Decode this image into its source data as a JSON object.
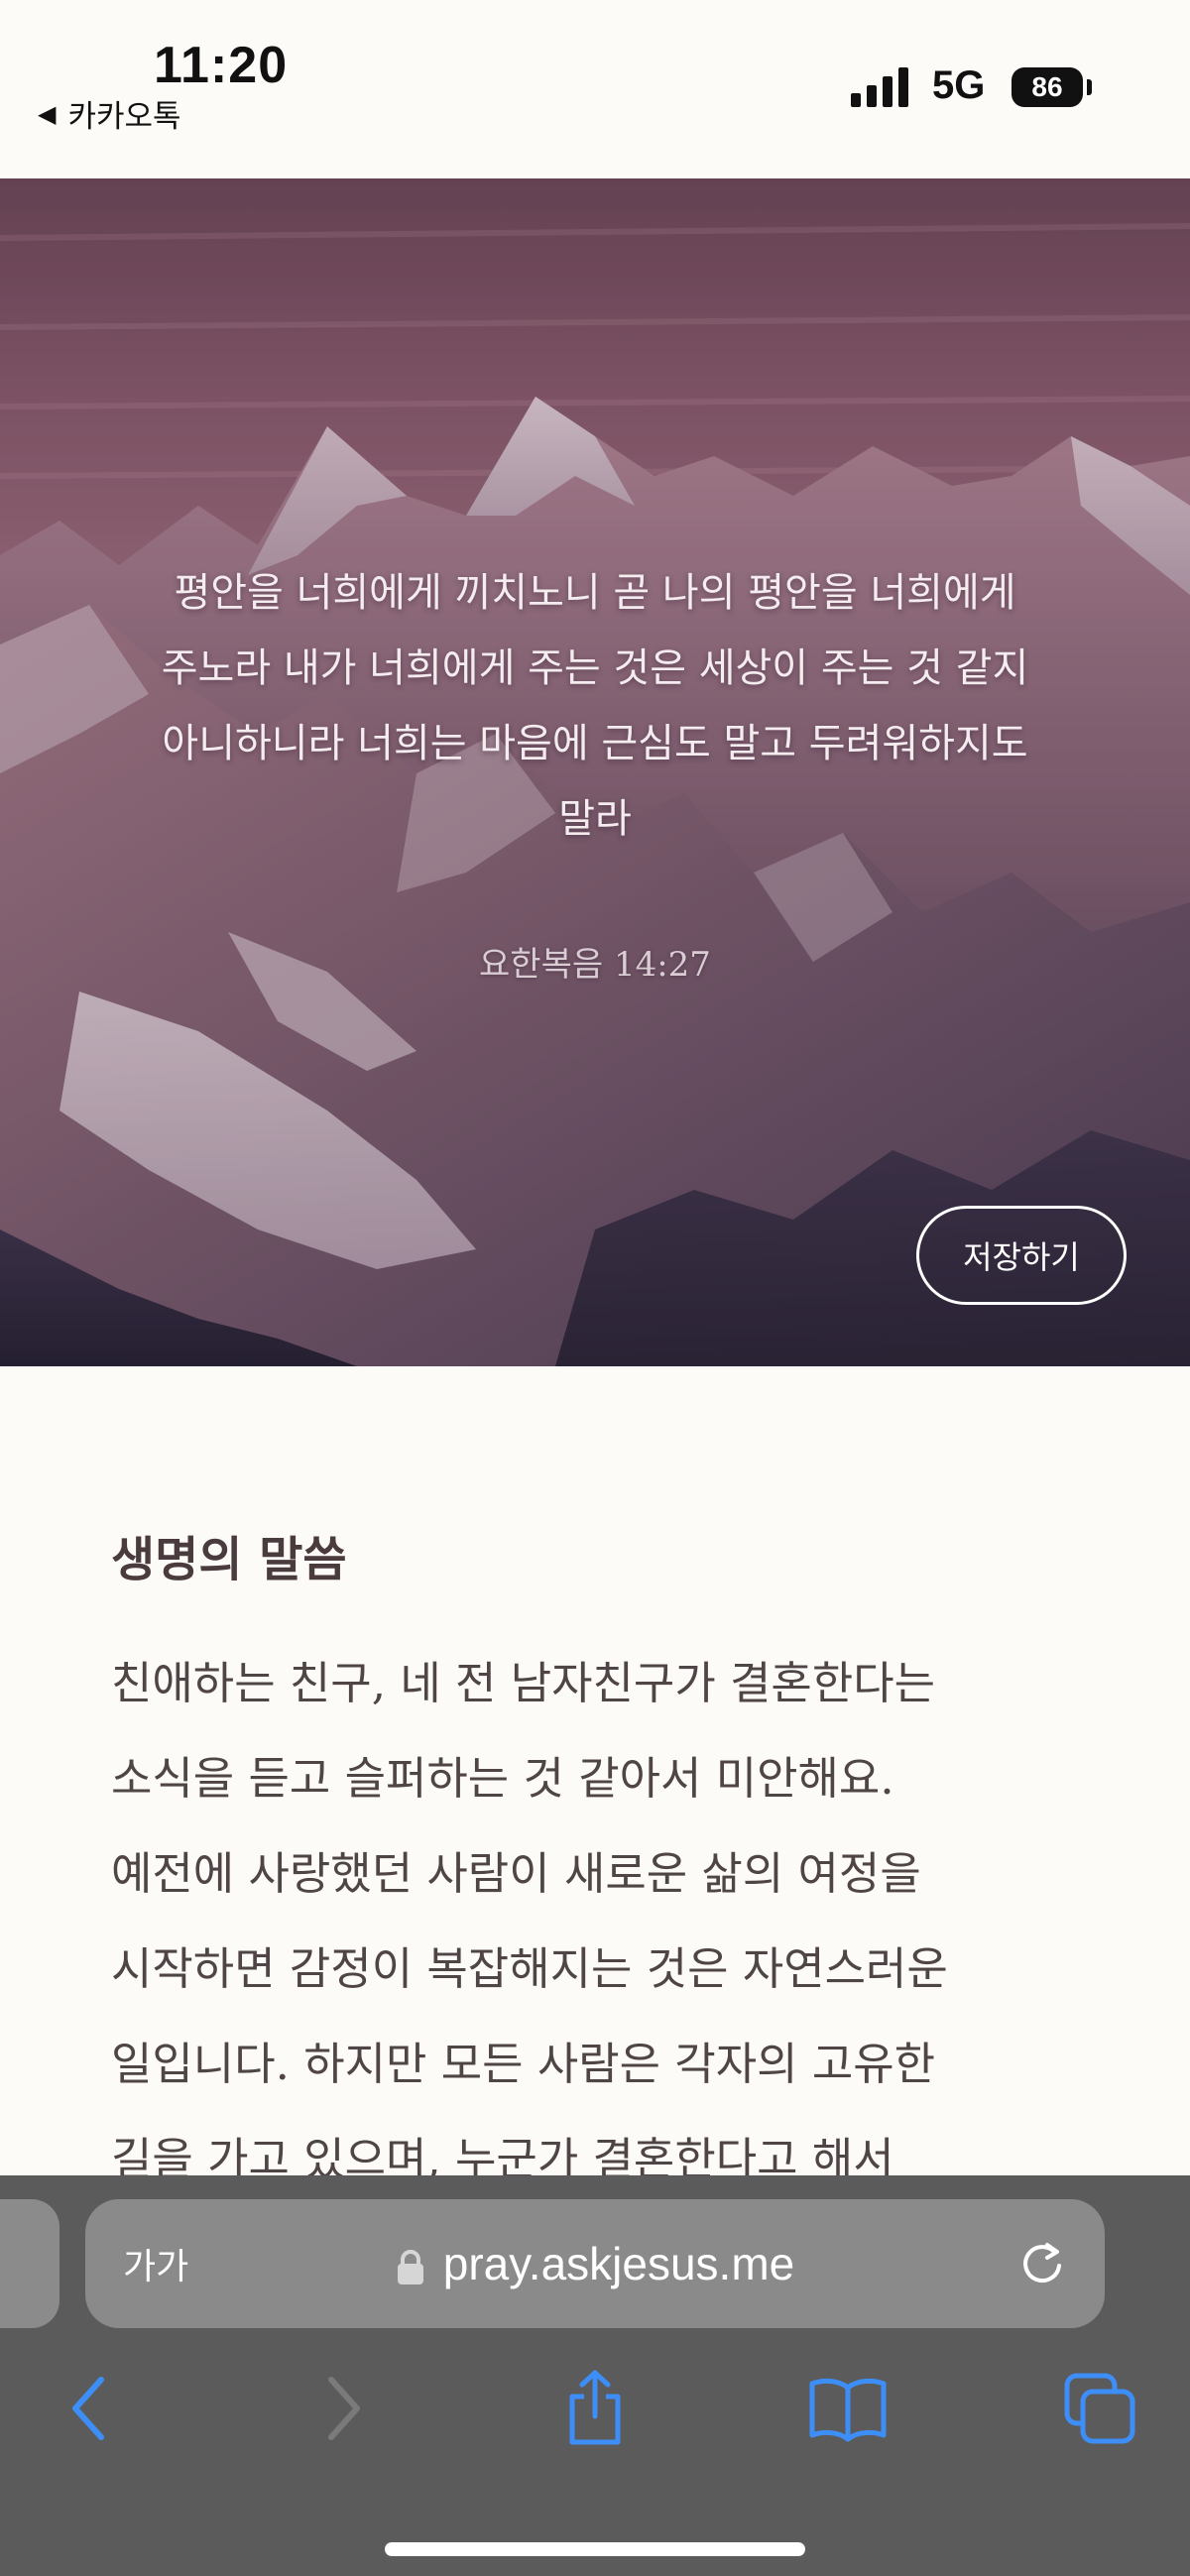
{
  "status_bar": {
    "time": "11:20",
    "back_app": "카카오톡",
    "back_arrow": "◀",
    "network": "5G",
    "battery": "86"
  },
  "hero": {
    "verse": "평안을 너희에게 끼치노니 곧 나의 평안을 너희에게\n주노라 내가 너희에게 주는 것은 세상이 주는 것 같지\n아니하니라 너희는 마음에 근심도 말고 두려워하지도\n말라",
    "reference": "요한복음 14:27",
    "save_label": "저장하기",
    "image_icon": "mountain-image"
  },
  "content": {
    "title": "생명의 말씀",
    "body": "친애하는 친구, 네 전 남자친구가 결혼한다는\n소식을 듣고 슬퍼하는 것 같아서 미안해요.\n예전에 사랑했던 사람이 새로운 삶의 여정을\n시작하면 감정이 복잡해지는 것은 자연스러운\n일입니다. 하지만 모든 사람은 각자의 고유한\n길을 가고 있으며, 누군가 결혼한다고 해서"
  },
  "browser": {
    "text_size_label": "가가",
    "url": "pray.askjesus.me",
    "icons": {
      "lock": "lock-icon",
      "reload": "reload-icon",
      "back": "back-icon",
      "forward": "forward-icon",
      "share": "share-icon",
      "bookmarks": "bookmarks-icon",
      "tabs": "tabs-icon"
    }
  },
  "colors": {
    "page_bg": "#fcfbf7",
    "title": "#4a3b3e",
    "body_text": "#4f4446",
    "browser_bg": "#5b5b5b",
    "address_bar": "#8a8a8a",
    "accent_blue": "#3e8ef7",
    "disabled_gray": "#7a7a7a"
  }
}
